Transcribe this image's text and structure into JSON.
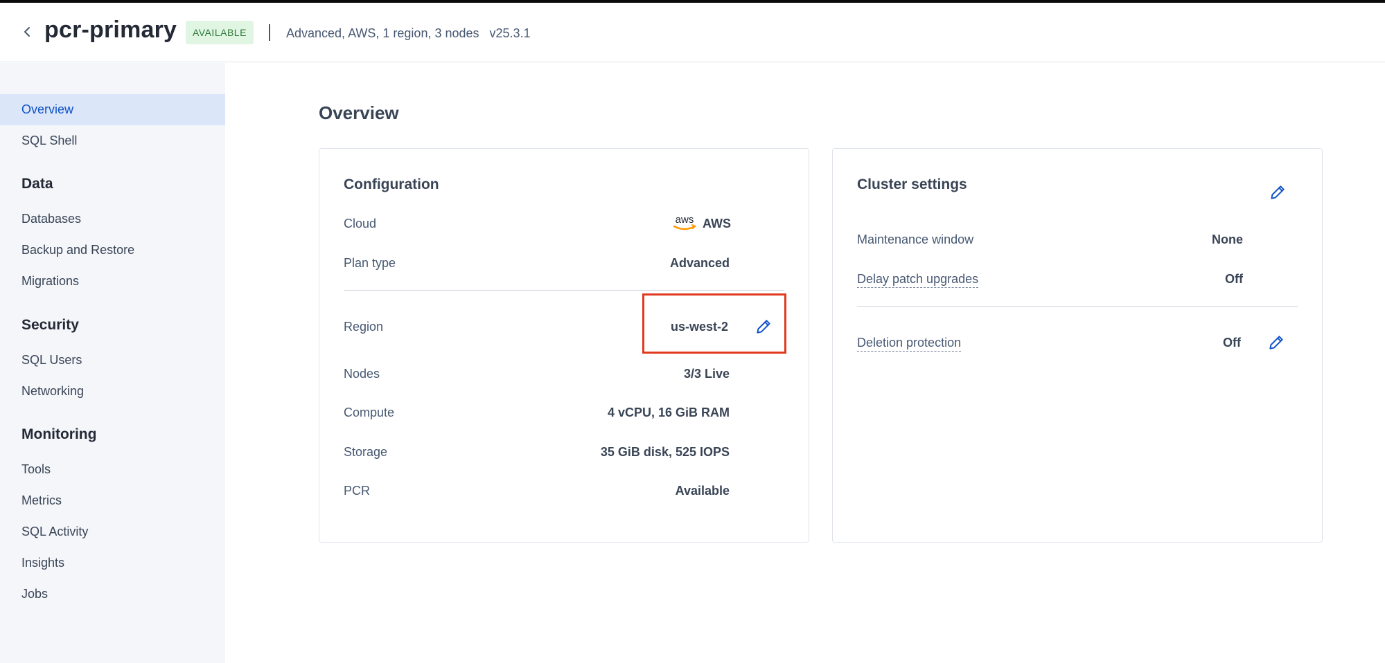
{
  "header": {
    "cluster_name": "pcr-primary",
    "status": "AVAILABLE",
    "meta": "Advanced, AWS, 1 region, 3 nodes",
    "version": "v25.3.1"
  },
  "sidebar": {
    "items": [
      {
        "label": "Overview",
        "active": true
      },
      {
        "label": "SQL Shell"
      }
    ],
    "sections": [
      {
        "title": "Data",
        "items": [
          "Databases",
          "Backup and Restore",
          "Migrations"
        ]
      },
      {
        "title": "Security",
        "items": [
          "SQL Users",
          "Networking"
        ]
      },
      {
        "title": "Monitoring",
        "items": [
          "Tools",
          "Metrics",
          "SQL Activity",
          "Insights",
          "Jobs"
        ]
      }
    ]
  },
  "main": {
    "title": "Overview",
    "configuration": {
      "title": "Configuration",
      "cloud_label": "Cloud",
      "cloud_logo_text": "aws",
      "cloud_value": "AWS",
      "plan_label": "Plan type",
      "plan_value": "Advanced",
      "region_label": "Region",
      "region_value": "us-west-2",
      "nodes_label": "Nodes",
      "nodes_value": "3/3 Live",
      "compute_label": "Compute",
      "compute_value": "4 vCPU, 16 GiB RAM",
      "storage_label": "Storage",
      "storage_value": "35 GiB disk, 525 IOPS",
      "pcr_label": "PCR",
      "pcr_value": "Available"
    },
    "cluster_settings": {
      "title": "Cluster settings",
      "maintenance_label": "Maintenance window",
      "maintenance_value": "None",
      "delay_label": "Delay patch upgrades",
      "delay_value": "Off",
      "deletion_label": "Deletion protection",
      "deletion_value": "Off"
    }
  },
  "colors": {
    "accent": "#0e52c8",
    "badge_bg": "#e1f5e3",
    "badge_text": "#2f7a3a",
    "highlight": "#e03a1e",
    "aws_orange": "#ff9900"
  },
  "icons": {
    "back": "chevron-left-icon",
    "edit": "pencil-icon",
    "cloud": "aws-logo"
  }
}
